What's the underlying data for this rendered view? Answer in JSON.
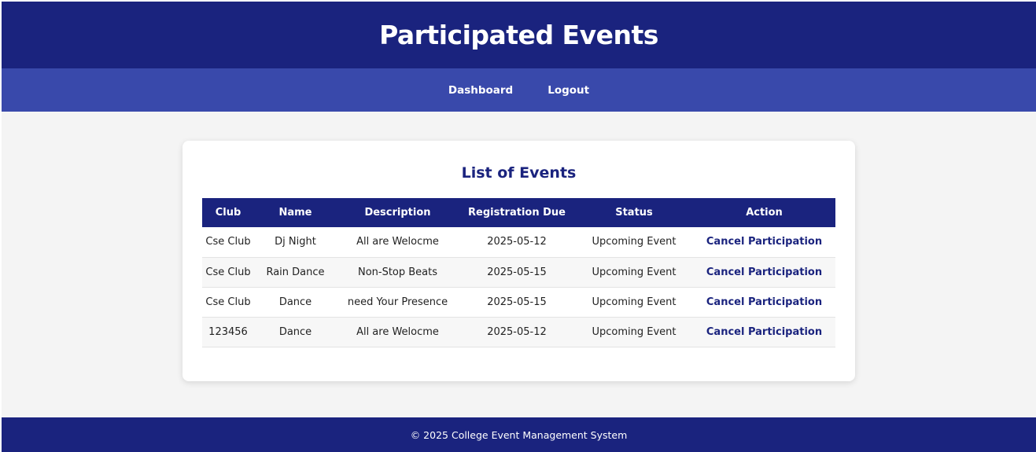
{
  "header": {
    "title": "Participated Events"
  },
  "nav": {
    "items": [
      {
        "label": "Dashboard"
      },
      {
        "label": "Logout"
      }
    ]
  },
  "main": {
    "section_title": "List of Events",
    "columns": [
      "Club",
      "Name",
      "Description",
      "Registration Due",
      "Status",
      "Action"
    ],
    "rows": [
      {
        "club": "Cse Club",
        "name": "Dj Night",
        "description": "All are Welocme",
        "due": "2025-05-12",
        "status": "Upcoming Event",
        "action": "Cancel Participation"
      },
      {
        "club": "Cse Club",
        "name": "Rain Dance",
        "description": "Non-Stop Beats",
        "due": "2025-05-15",
        "status": "Upcoming Event",
        "action": "Cancel Participation"
      },
      {
        "club": "Cse Club",
        "name": "Dance",
        "description": "need Your Presence",
        "due": "2025-05-15",
        "status": "Upcoming Event",
        "action": "Cancel Participation"
      },
      {
        "club": "123456",
        "name": "Dance",
        "description": "All are Welocme",
        "due": "2025-05-12",
        "status": "Upcoming Event",
        "action": "Cancel Participation"
      }
    ]
  },
  "footer": {
    "text": "© 2025 College Event Management System"
  },
  "colors": {
    "primary": "#1a237e",
    "nav": "#3949ab",
    "background": "#f4f4f4"
  }
}
